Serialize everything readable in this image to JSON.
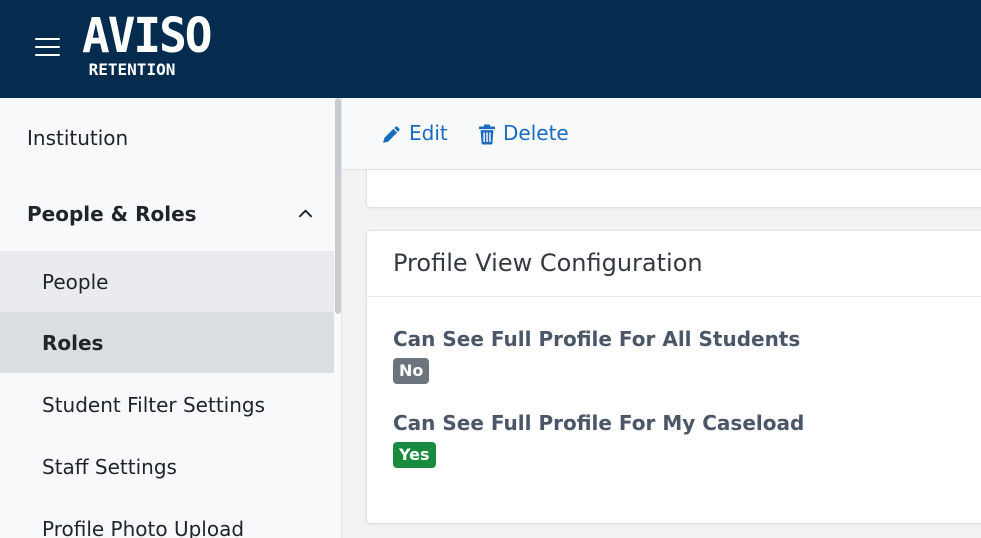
{
  "header": {
    "logo_main": "AVISO",
    "logo_sub": "RETENTION"
  },
  "sidebar": {
    "items": [
      {
        "label": "Institution"
      },
      {
        "label": "People & Roles",
        "expanded": true
      },
      {
        "label": "People"
      },
      {
        "label": "Roles",
        "active": true
      },
      {
        "label": "Student Filter Settings"
      },
      {
        "label": "Staff Settings"
      },
      {
        "label": "Profile Photo Upload"
      }
    ]
  },
  "toolbar": {
    "edit_label": "Edit",
    "delete_label": "Delete"
  },
  "profile_view": {
    "title": "Profile View Configuration",
    "permissions": [
      {
        "label": "Can See Full Profile For All Students",
        "value": "No"
      },
      {
        "label": "Can See Full Profile For My Caseload",
        "value": "Yes"
      }
    ]
  },
  "colors": {
    "header_bg": "#052c4f",
    "accent": "#1a6bbf",
    "badge_no": "#6c757d",
    "badge_yes": "#198b3e"
  },
  "icons": {
    "menu": "hamburger-menu-icon",
    "collapse": "chevron-up-icon",
    "edit": "pencil-icon",
    "delete": "trash-icon"
  }
}
